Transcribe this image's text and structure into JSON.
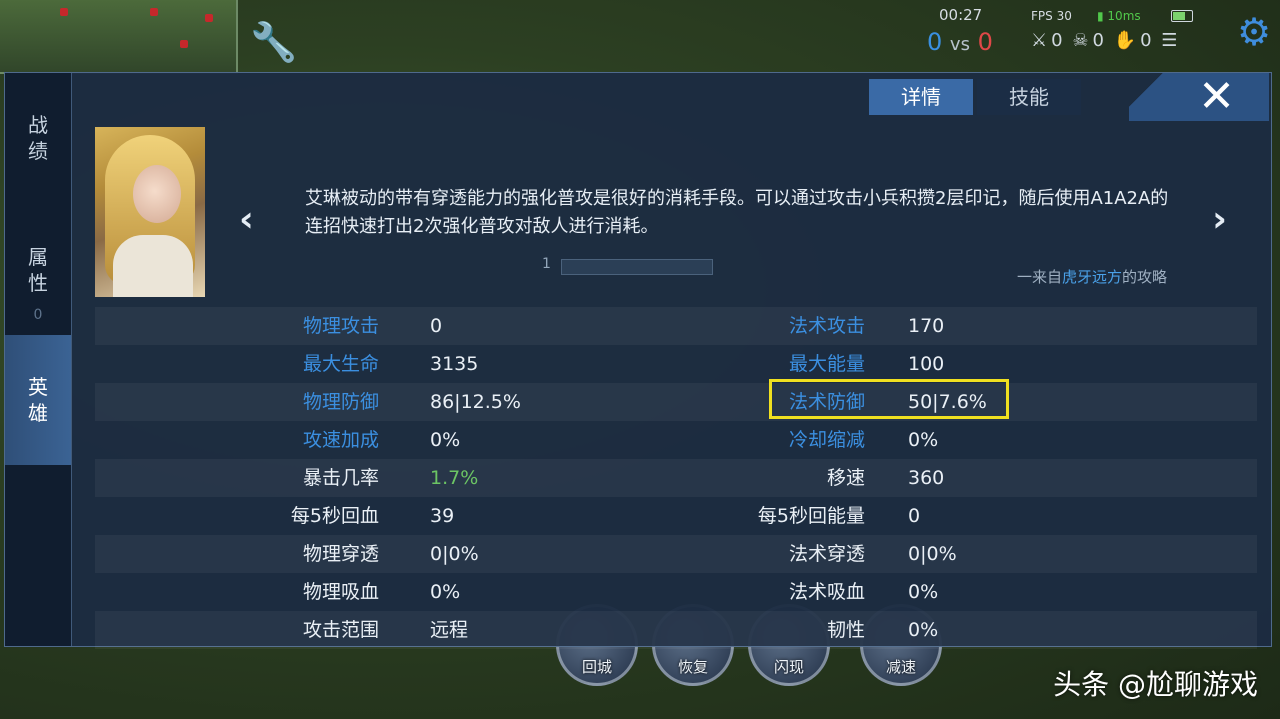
{
  "hud": {
    "timer": "00:27",
    "fps": "FPS 30",
    "ping": "10ms",
    "score_blue": "0",
    "score_vs": "vs",
    "score_red": "0",
    "kills": "0",
    "deaths": "0",
    "assists": "0"
  },
  "panel": {
    "side_tabs": [
      "战绩",
      "属性",
      "英雄"
    ],
    "side_tab_counter": "0",
    "tabs": [
      "详情",
      "技能"
    ],
    "tip_text": "艾琳被动的带有穿透能力的强化普攻是很好的消耗手段。可以通过攻击小兵积攒2层印记，随后使用A1A2A的连招快速打出2次强化普攻对敌人进行消耗。",
    "credit_prefix": "一来自",
    "credit_name": "虎牙远方",
    "credit_suffix": "的攻略",
    "page_indicator": "1",
    "stats": [
      {
        "l1": "物理攻击",
        "v1": "0",
        "l2": "法术攻击",
        "v2": "170"
      },
      {
        "l1": "最大生命",
        "v1": "3135",
        "l2": "最大能量",
        "v2": "100"
      },
      {
        "l1": "物理防御",
        "v1": "86|12.5%",
        "l2": "法术防御",
        "v2": "50|7.6%"
      },
      {
        "l1": "攻速加成",
        "v1": "0%",
        "l2": "冷却缩减",
        "v2": "0%"
      },
      {
        "l1": "暴击几率",
        "v1": "1.7%",
        "l2": "移速",
        "v2": "360"
      },
      {
        "l1": "每5秒回血",
        "v1": "39",
        "l2": "每5秒回能量",
        "v2": "0"
      },
      {
        "l1": "物理穿透",
        "v1": "0|0%",
        "l2": "法术穿透",
        "v2": "0|0%"
      },
      {
        "l1": "物理吸血",
        "v1": "0%",
        "l2": "法术吸血",
        "v2": "0%"
      },
      {
        "l1": "攻击范围",
        "v1": "远程",
        "l2": "韧性",
        "v2": "0%"
      }
    ]
  },
  "skills": [
    "回城",
    "恢复",
    "闪现",
    "减速"
  ],
  "watermark": "头条 @尬聊游戏",
  "colors": {
    "accent_blue": "#3b8fe0",
    "highlight_yellow": "#f0e020",
    "positive_green": "#6cc564"
  }
}
